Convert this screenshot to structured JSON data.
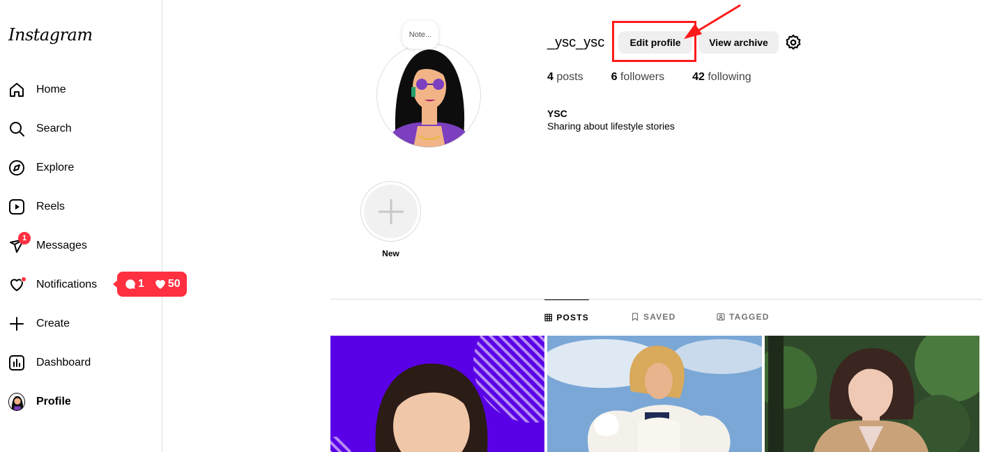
{
  "app": {
    "logo": "Instagram"
  },
  "sidebar": {
    "items": [
      {
        "label": "Home",
        "icon": "home-icon"
      },
      {
        "label": "Search",
        "icon": "search-icon"
      },
      {
        "label": "Explore",
        "icon": "compass-icon"
      },
      {
        "label": "Reels",
        "icon": "reels-icon"
      },
      {
        "label": "Messages",
        "icon": "messenger-icon",
        "badge": "1"
      },
      {
        "label": "Notifications",
        "icon": "heart-icon"
      },
      {
        "label": "Create",
        "icon": "plus-icon"
      },
      {
        "label": "Dashboard",
        "icon": "dashboard-icon"
      },
      {
        "label": "Profile",
        "icon": "avatar"
      }
    ],
    "notification_popup": {
      "comments": "1",
      "likes": "50"
    }
  },
  "profile": {
    "note": "Note...",
    "username": "_ysc_ysc",
    "edit_button": "Edit profile",
    "archive_button": "View archive",
    "stats": {
      "posts_count": "4",
      "posts_label": "posts",
      "followers_count": "6",
      "followers_label": "followers",
      "following_count": "42",
      "following_label": "following"
    },
    "full_name": "YSC",
    "bio": "Sharing about lifestyle stories",
    "highlight_new": "New"
  },
  "tabs": [
    {
      "label": "POSTS",
      "active": true
    },
    {
      "label": "SAVED",
      "active": false
    },
    {
      "label": "TAGGED",
      "active": false
    }
  ],
  "colors": {
    "accent_red": "#ff3040",
    "annotation": "#ff1a1a",
    "button_bg": "#efefef"
  }
}
